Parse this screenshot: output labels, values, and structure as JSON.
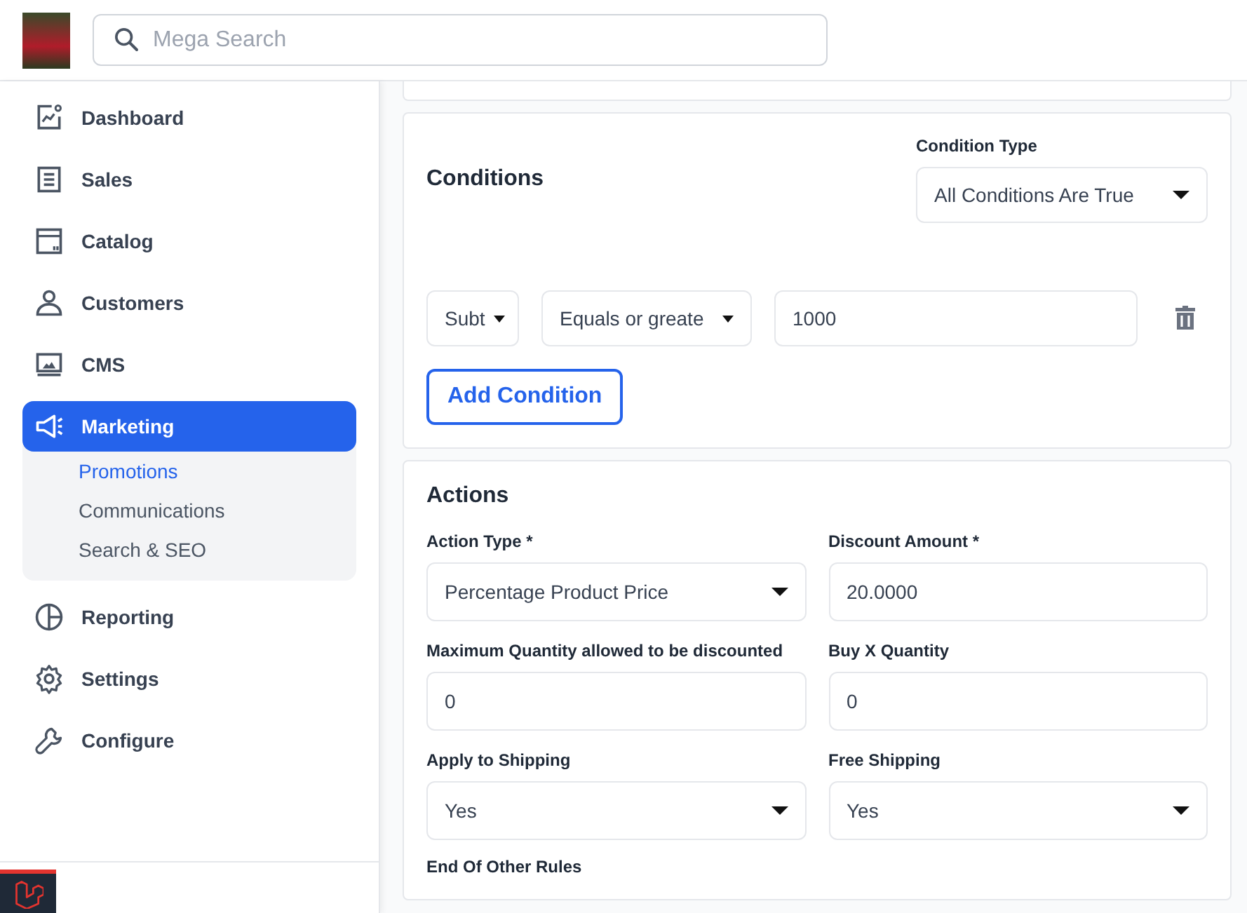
{
  "search": {
    "placeholder": "Mega Search"
  },
  "sidebar": {
    "items": [
      {
        "label": "Dashboard",
        "selected": false
      },
      {
        "label": "Sales",
        "selected": false
      },
      {
        "label": "Catalog",
        "selected": false
      },
      {
        "label": "Customers",
        "selected": false
      },
      {
        "label": "CMS",
        "selected": false
      },
      {
        "label": "Marketing",
        "selected": true,
        "children": [
          {
            "label": "Promotions",
            "selected": true
          },
          {
            "label": "Communications",
            "selected": false
          },
          {
            "label": "Search & SEO",
            "selected": false
          }
        ]
      },
      {
        "label": "Reporting",
        "selected": false
      },
      {
        "label": "Settings",
        "selected": false
      },
      {
        "label": "Configure",
        "selected": false
      }
    ]
  },
  "conditions": {
    "title": "Conditions",
    "condition_type": {
      "label": "Condition Type",
      "value": "All Conditions Are True"
    },
    "rows": [
      {
        "attribute": "Subt",
        "operator": "Equals or greate",
        "value": "1000"
      }
    ],
    "add_button": "Add Condition"
  },
  "actions": {
    "title": "Actions",
    "fields": [
      {
        "label": "Action Type *",
        "value": "Percentage Product Price",
        "kind": "select"
      },
      {
        "label": "Discount Amount *",
        "value": "20.0000",
        "kind": "input"
      },
      {
        "label": "Maximum Quantity allowed to be discounted",
        "value": "0",
        "kind": "input"
      },
      {
        "label": "Buy X Quantity",
        "value": "0",
        "kind": "input"
      },
      {
        "label": "Apply to Shipping",
        "value": "Yes",
        "kind": "select"
      },
      {
        "label": "Free Shipping",
        "value": "Yes",
        "kind": "select"
      }
    ],
    "next_label": "End Of Other Rules"
  }
}
